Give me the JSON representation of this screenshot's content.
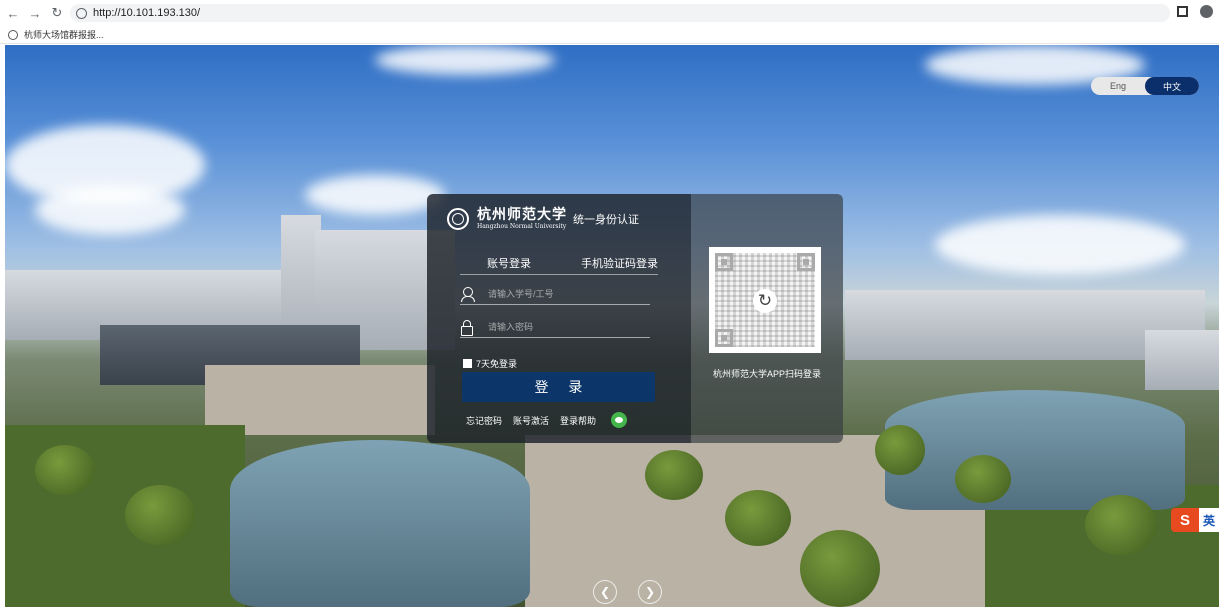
{
  "browser": {
    "url": "http://10.101.193.130/",
    "bookmark": "杭师大场馆群报报..."
  },
  "lang": {
    "eng": "Eng",
    "zh": "中文"
  },
  "brand": {
    "cn": "杭州师范大学",
    "en": "Hangzhou Normal University",
    "suffix": "统一身份认证"
  },
  "tabs": {
    "account": "账号登录",
    "phone": "手机验证码登录"
  },
  "form": {
    "user_placeholder": "请输入学号/工号",
    "pass_placeholder": "请输入密码",
    "remember": "7天免登录",
    "login": "登 录"
  },
  "links": {
    "forgot": "忘记密码",
    "activate": "账号激活",
    "help": "登录帮助"
  },
  "qr": {
    "label": "杭州师范大学APP扫码登录"
  },
  "ime": {
    "logo": "S",
    "mode": "英"
  },
  "colors": {
    "accent": "#0c3569",
    "wechat": "#43b54a",
    "lang_active": "#0a2f6b"
  }
}
